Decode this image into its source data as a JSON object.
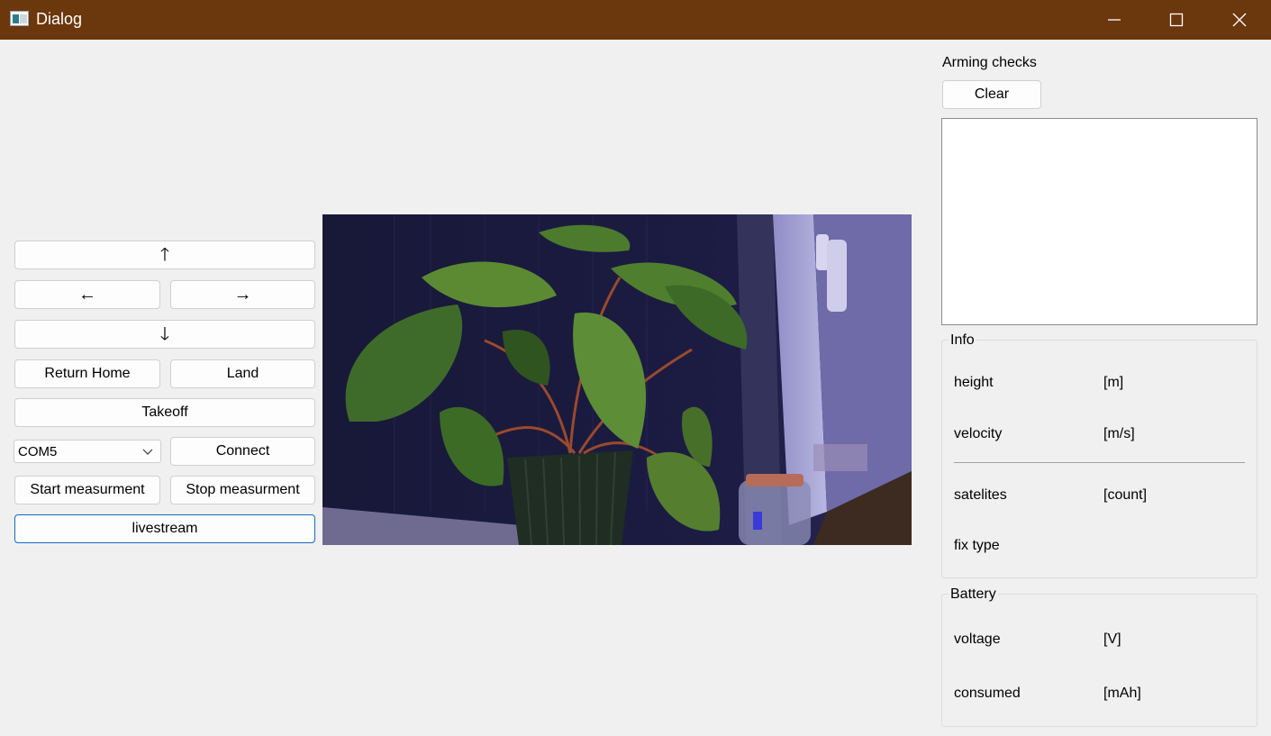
{
  "window": {
    "title": "Dialog"
  },
  "controls": {
    "up": "🡑",
    "left": "←",
    "right": "→",
    "down": "🡓",
    "return_home": "Return Home",
    "land": "Land",
    "takeoff": "Takeoff",
    "port": "COM5",
    "connect": "Connect",
    "start_measurement": "Start measurment",
    "stop_measurement": "Stop measurment",
    "livestream": "livestream"
  },
  "arming": {
    "label": "Arming checks",
    "clear": "Clear",
    "log": ""
  },
  "info": {
    "title": "Info",
    "rows": [
      {
        "label": "height",
        "unit": "[m]"
      },
      {
        "label": "velocity",
        "unit": "[m/s]"
      },
      {
        "label": "satelites",
        "unit": "[count]"
      },
      {
        "label": "fix type",
        "unit": ""
      }
    ]
  },
  "battery": {
    "title": "Battery",
    "rows": [
      {
        "label": "voltage",
        "unit": "[V]"
      },
      {
        "label": "consumed",
        "unit": "[mAh]"
      }
    ]
  },
  "colors": {
    "titlebar": "#6b370c",
    "background": "#f0f0f0",
    "focus_border": "#0f6cbd"
  }
}
